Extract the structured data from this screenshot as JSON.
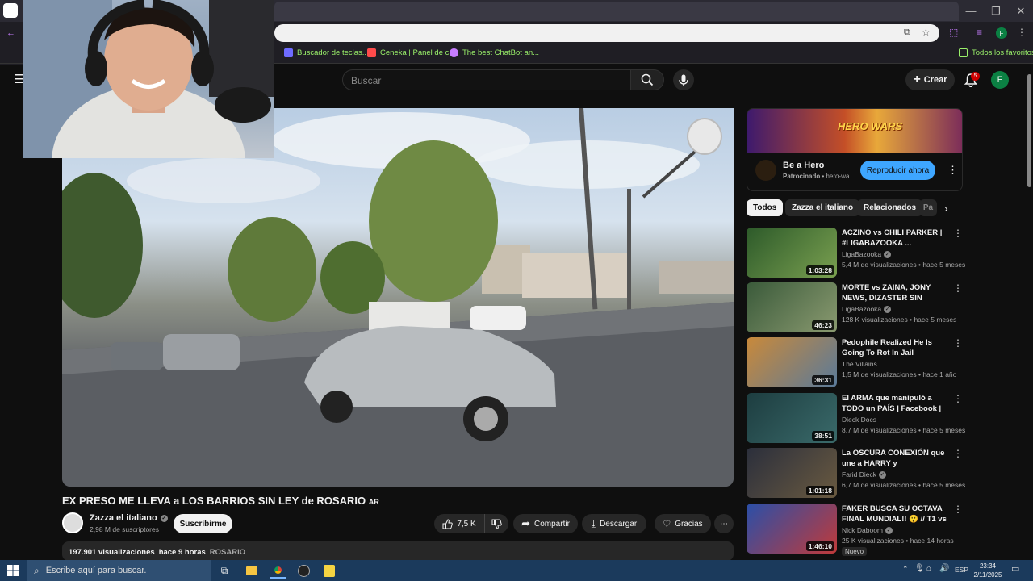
{
  "bookmarks": [
    {
      "label": "Buscador de teclas...",
      "color": "#6e6bff"
    },
    {
      "label": "Ceneka | Panel de c...",
      "color": "#ff4b4b"
    },
    {
      "label": "The best ChatBot an...",
      "color": "#c77dff"
    }
  ],
  "bookmarks_all": "Todos los favoritos",
  "header": {
    "search_placeholder": "Buscar",
    "create_label": "Crear",
    "notifications_count": "5",
    "avatar_letter": "F"
  },
  "video": {
    "title": "EX PRESO ME LLEVA a LOS BARRIOS SIN LEY de ROSARIO",
    "title_flag": "AR",
    "channel": "Zazza el italiano",
    "subscribers": "2,98 M de suscriptores",
    "subscribe_label": "Suscribirme",
    "likes": "7,5 K",
    "share_label": "Compartir",
    "download_label": "Descargar",
    "thanks_label": "Gracias",
    "views": "197.901 visualizaciones",
    "age": "hace 9 horas",
    "tag": "ROSARIO"
  },
  "ad": {
    "banner_text": "HERO WARS",
    "title": "Be a Hero",
    "sponsored": "Patrocinado",
    "domain": "hero-wa...",
    "cta": "Reproducir ahora"
  },
  "chips": [
    "Todos",
    "Zazza el italiano",
    "Relacionados",
    "Pa"
  ],
  "recommendations": [
    {
      "title": "ACZINO vs CHILI PARKER | #LIGABAZOOKA ...",
      "channel": "LigaBazooka",
      "verified": true,
      "views": "5,4 M de visualizaciones",
      "age": "hace 5 meses",
      "duration": "1:03:28",
      "thumb_color": "#2d5a2a"
    },
    {
      "title": "MORTE vs ZAINA, JONY NEWS, DIZASTER SIN TRADUCTOR, U...",
      "channel": "LigaBazooka",
      "verified": true,
      "views": "128 K visualizaciones",
      "age": "hace 5 meses",
      "duration": "46:23",
      "thumb_color": "#3a5a3a"
    },
    {
      "title": "Pedophile Realized He Is Going To Rot In Jail",
      "channel": "The Villains",
      "verified": false,
      "views": "1,5 M de visualizaciones",
      "age": "hace 1 año",
      "duration": "36:31",
      "thumb_color": "#c9893a"
    },
    {
      "title": "El ARMA que manipuló a TODO un PAÍS | Facebook | ...",
      "channel": "Dieck Docs",
      "verified": false,
      "views": "8,7 M de visualizaciones",
      "age": "hace 5 meses",
      "duration": "38:51",
      "thumb_color": "#1d3d40"
    },
    {
      "title": "La OSCURA CONEXIÓN que une a HARRY y VOLDEMORT | Harr...",
      "channel": "Farid Dieck",
      "verified": true,
      "views": "6,7 M de visualizaciones",
      "age": "hace 5 meses",
      "duration": "1:01:18",
      "thumb_color": "#2b2f3c"
    },
    {
      "title": "FAKER BUSCA SU OCTAVA FINAL MUNDIAL!! 😲 // T1 vs ...",
      "channel": "Nick Daboom",
      "verified": true,
      "views": "25 K visualizaciones",
      "age": "hace 14 horas",
      "duration": "1:46:10",
      "thumb_color": "#2a4fa8",
      "badge": "Nuevo"
    }
  ],
  "taskbar": {
    "search_placeholder": "Escribe aquí para buscar.",
    "language": "ESP",
    "time": "23:34",
    "date": "2/11/2025"
  }
}
